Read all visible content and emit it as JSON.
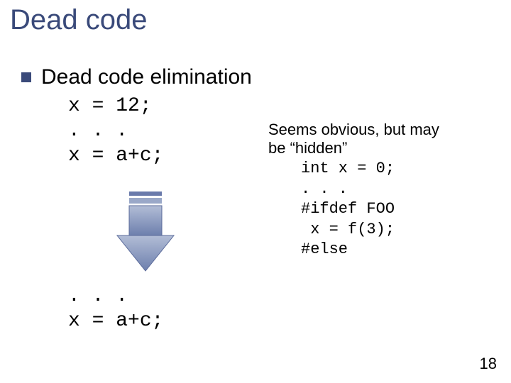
{
  "title": "Dead code",
  "bullet": "Dead code elimination",
  "code_before": "x = 12;\n. . .\nx = a+c;",
  "code_after": ". . .\nx = a+c;",
  "note_line1": "Seems obvious, but may",
  "note_line2": "be “hidden”",
  "note_code": "int x = 0;\n. . .\n#ifdef FOO\n x = f(3);\n#else",
  "page_number": "18",
  "icons": {
    "bullet": "square-bullet-icon",
    "arrow": "down-arrow-icon"
  },
  "colors": {
    "title": "#3a4a7a",
    "bullet_fill": "#3a4a7a",
    "arrow_body": "#8c9cbf",
    "arrow_outline": "#5a6a9a",
    "arrow_tail1": "#6a7aab",
    "arrow_tail2": "#9aa8c8"
  }
}
